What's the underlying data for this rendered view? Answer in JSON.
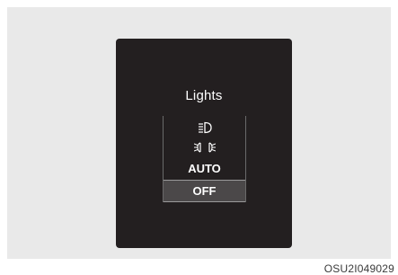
{
  "panel": {
    "title": "Lights",
    "items": [
      {
        "icon": "headlamp-icon"
      },
      {
        "icon": "parking-lights-icon"
      },
      {
        "label": "AUTO"
      },
      {
        "label": "OFF",
        "selected": true
      }
    ]
  },
  "figure_code": "OSU2I049029",
  "colors": {
    "panel_background": "#231f20",
    "selection_background": "#4b4849",
    "text": "#ffffff",
    "backdrop": "#e9e9e9"
  }
}
